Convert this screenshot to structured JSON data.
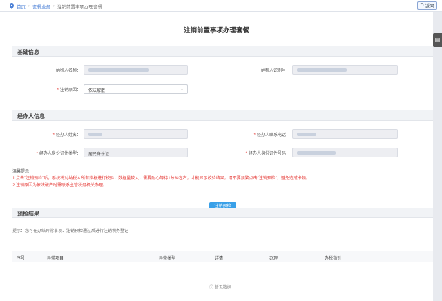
{
  "breadcrumb": {
    "home": "首页",
    "package": "套餐业务",
    "current": "注销前置事项办理套餐"
  },
  "back_label": "返回",
  "page_title": "注销前置事项办理套餐",
  "section_basic": {
    "title": "基础信息",
    "taxpayer_name_label": "纳税人名称：",
    "taxpayer_id_label": "纳税人识别号：",
    "cancel_reason_label": "注销原因：",
    "cancel_reason_value": "依法解散"
  },
  "section_agent": {
    "title": "经办人信息",
    "agent_name_label": "经办人姓名：",
    "agent_phone_label": "经办人联系电话：",
    "id_type_label": "经办人身份证件类型：",
    "id_type_value": "居民身份证",
    "id_number_label": "经办人身份证件号码："
  },
  "tips": {
    "title": "温馨提示：",
    "line1": "1.点击\"注销预检\"后，系统将对纳税人所有指标进行校验，数据量较大，需要耐心等待1分钟左右，才能显示校验结果，请不要频繁点击\"注销预检\"，避免造成卡顿。",
    "line2": "2.注销原因为依法破产时需联系主管税务机关办理。"
  },
  "precheck_button": "注销预检",
  "section_result": {
    "title": "预检结果",
    "hint": "提示：您可在办结异常事项、注销预检通过后进行注销税务登记",
    "columns": [
      "序号",
      "异常项目",
      "异常类型",
      "详情",
      "办理",
      "办税指引"
    ],
    "empty": "暂无数据"
  },
  "side_tool_icon": "book-icon",
  "colors": {
    "primary_button": "#39a0e8",
    "required_star": "#e53935",
    "warning_text": "#e53935",
    "link": "#4a7fd6"
  }
}
